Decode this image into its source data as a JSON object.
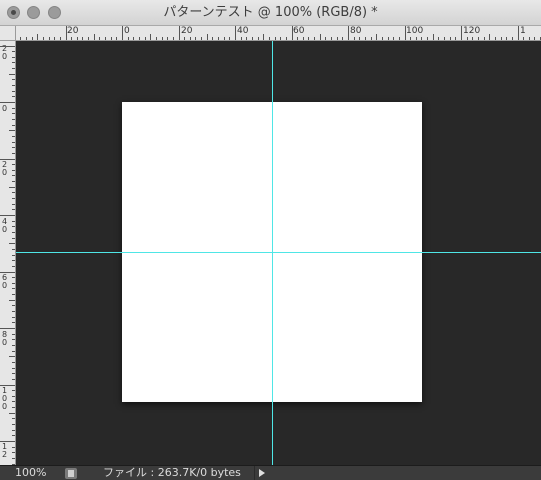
{
  "window": {
    "title": "パターンテスト @ 100% (RGB/8) *",
    "controls": [
      "close-icon",
      "minimize-icon",
      "zoom-icon"
    ]
  },
  "ruler_top": {
    "labels": [
      "20",
      "0",
      "20",
      "40",
      "60",
      "80",
      "100",
      "120",
      "1"
    ]
  },
  "ruler_left": {
    "labels": [
      [
        "2",
        "0"
      ],
      [
        "0"
      ],
      [
        "2",
        "0"
      ],
      [
        "4",
        "0"
      ],
      [
        "6",
        "0"
      ],
      [
        "8",
        "0"
      ],
      [
        "1",
        "0",
        "0"
      ],
      [
        "1",
        "2"
      ]
    ]
  },
  "guides": {
    "color": "#4fe6e6"
  },
  "document": {
    "background": "#ffffff"
  },
  "status": {
    "zoom": "100%",
    "file_info": "ファイル : 263.7K/0 bytes",
    "menu_arrow_icon": "right-triangle-icon"
  }
}
